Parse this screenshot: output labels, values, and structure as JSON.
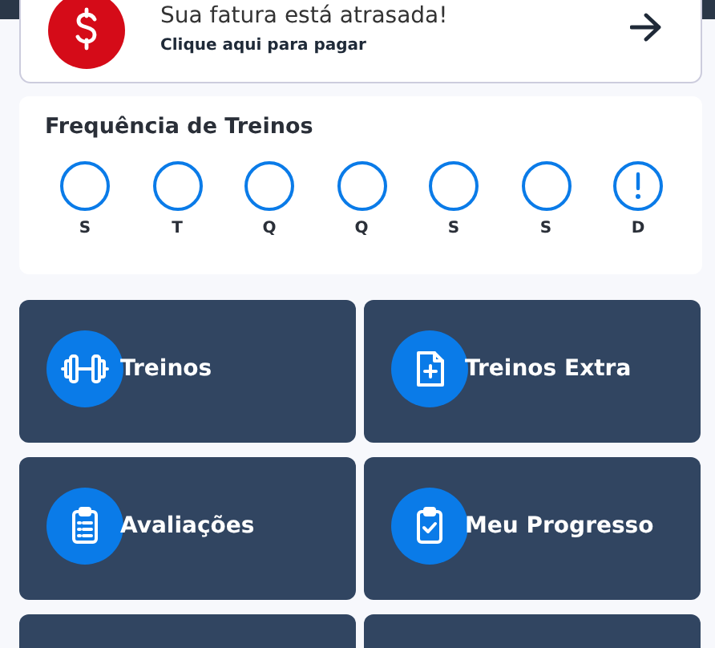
{
  "invoice_alert": {
    "title": "Sua fatura está atrasada!",
    "link": "Clique aqui para pagar"
  },
  "frequency": {
    "title": "Frequência de Treinos",
    "days": [
      {
        "label": "S",
        "alert": false
      },
      {
        "label": "T",
        "alert": false
      },
      {
        "label": "Q",
        "alert": false
      },
      {
        "label": "Q",
        "alert": false
      },
      {
        "label": "S",
        "alert": false
      },
      {
        "label": "S",
        "alert": false
      },
      {
        "label": "D",
        "alert": true
      }
    ]
  },
  "tiles": [
    {
      "label": "Treinos"
    },
    {
      "label": "Treinos Extra"
    },
    {
      "label": "Avaliações"
    },
    {
      "label": "Meu Progresso"
    }
  ]
}
